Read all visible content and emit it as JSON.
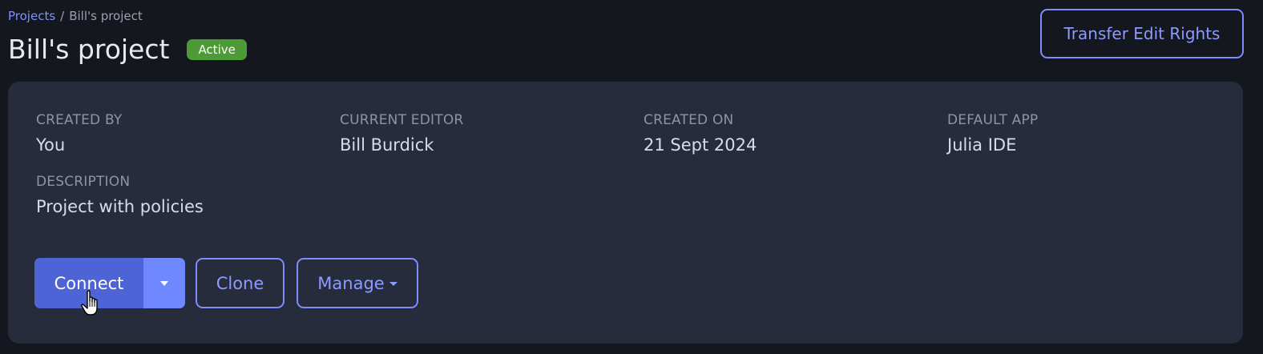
{
  "breadcrumb": {
    "projects_link": "Projects",
    "separator": "/",
    "current": "Bill's project"
  },
  "header": {
    "title": "Bill's project",
    "status_badge": "Active",
    "transfer_button": "Transfer Edit Rights"
  },
  "details": {
    "created_by": {
      "label": "CREATED BY",
      "value": "You"
    },
    "current_editor": {
      "label": "CURRENT EDITOR",
      "value": "Bill Burdick"
    },
    "created_on": {
      "label": "CREATED ON",
      "value": "21 Sept 2024"
    },
    "default_app": {
      "label": "DEFAULT APP",
      "value": "Julia IDE"
    },
    "description": {
      "label": "DESCRIPTION",
      "value": "Project with policies"
    }
  },
  "actions": {
    "connect_label": "Connect",
    "clone_label": "Clone",
    "manage_label": "Manage"
  },
  "colors": {
    "background": "#15171e",
    "card": "#272c3d",
    "accent": "#7d8dff",
    "primary_button": "#4e63d6",
    "status_active": "#4d9b36"
  },
  "icons": {
    "connect_dropdown": "chevron-down-icon",
    "manage_dropdown": "chevron-down-icon",
    "cursor": "hand-pointer-icon"
  }
}
